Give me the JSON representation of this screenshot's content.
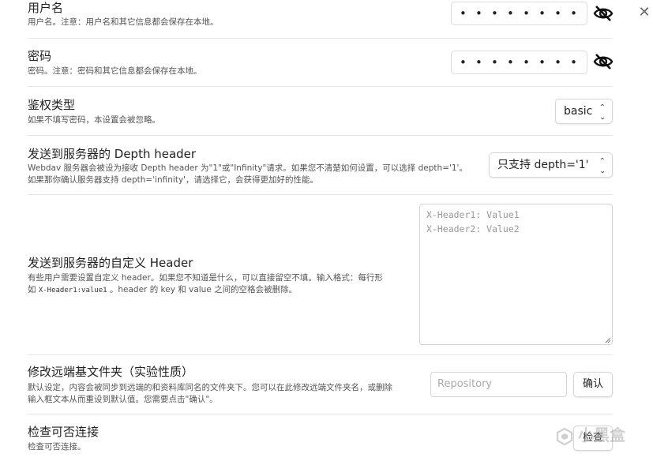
{
  "close": {
    "glyph": "✕"
  },
  "username": {
    "title": "用户名",
    "desc": "用户名。注意：用户名和其它信息都会保存在本地。",
    "value": "• • • • • • • • • • •",
    "toggle_icon": "eye-slash-icon"
  },
  "password": {
    "title": "密码",
    "desc": "密码。注意：密码和其它信息都会保存在本地。",
    "value": "• • • • • • • • • • • •",
    "toggle_icon": "eye-slash-icon"
  },
  "auth": {
    "title": "鉴权类型",
    "desc": "如果不填写密码，本设置会被忽略。",
    "selected": "basic"
  },
  "depth": {
    "title": "发送到服务器的 Depth header",
    "desc_line1": "Webdav 服务器会被设为接收 Depth header 为\"1\"或\"Infinity\"请求。如果您不清楚如何设置，可以选择 depth='1'。",
    "desc_line2": "如果那你确认服务器支持 depth='infinity'，请选择它，会获得更加好的性能。",
    "selected": "只支持 depth='1'"
  },
  "custom_header": {
    "title": "发送到服务器的自定义 Header",
    "desc_line1": "有些用户需要设置自定义 header。如果您不知道是什么，可以直接留空不填。输入格式：每行形",
    "desc_line2_pre": "如 ",
    "desc_line2_code": "X-Header1:value1",
    "desc_line2_post": " 。header 的 key 和 value 之间的空格会被删除。",
    "placeholder": "X-Header1: Value1\nX-Header2: Value2"
  },
  "remote_base": {
    "title": "修改远端基文件夹（实验性质）",
    "desc_line1": "默认设定，内容会被同步到远端的和资料库同名的文件夹下。您可以在此修改远端文件夹名，或删除",
    "desc_line2": "输入框文本从而重设到默认值。您需要点击\"确认\"。",
    "placeholder": "Repository",
    "confirm_label": "确认"
  },
  "check": {
    "title": "检查可否连接",
    "desc": "检查可否连接。",
    "button_label": "检查"
  },
  "watermark": {
    "text": "小黑盒"
  }
}
